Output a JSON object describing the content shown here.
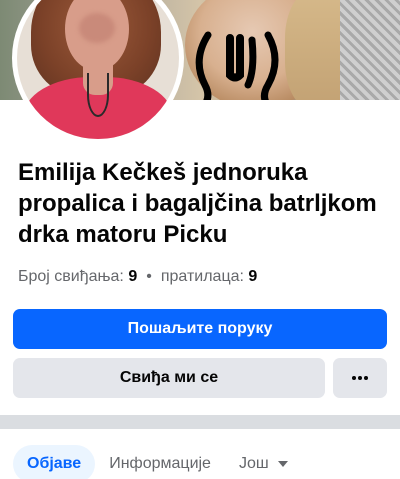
{
  "profile": {
    "name": "Emilija Kečkeš jednoruka propalica i bagaljčina batrljkom drka matoru Picku",
    "stats": {
      "likes_label": "Број свиђања:",
      "likes_count": "9",
      "separator": "•",
      "followers_label": "пратилаца:",
      "followers_count": "9"
    }
  },
  "actions": {
    "message_label": "Пошаљите поруку",
    "like_label": "Свиђа ми се",
    "more_icon": "more-dots-icon"
  },
  "tabs": [
    {
      "label": "Објаве",
      "active": true
    },
    {
      "label": "Информације",
      "active": false
    },
    {
      "label": "Још",
      "active": false
    }
  ],
  "colors": {
    "primary": "#0866ff",
    "secondary_bg": "#e4e6eb",
    "active_tab_bg": "#ebf5ff",
    "muted_text": "#65676b"
  }
}
